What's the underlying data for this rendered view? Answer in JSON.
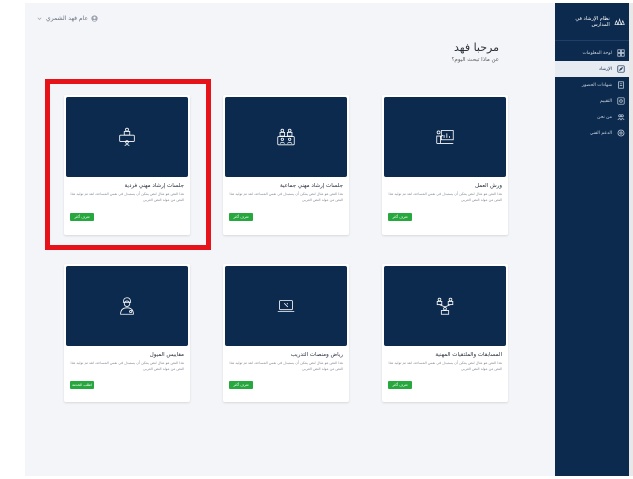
{
  "sidebar": {
    "title": "نظام الإرشاد في المدارس",
    "items": [
      {
        "label": "لوحة المعلومات",
        "icon": "grid-icon",
        "active": false
      },
      {
        "label": "الإرشاد",
        "icon": "compass-icon",
        "active": true
      },
      {
        "label": "شهادات الحضور",
        "icon": "certificate-icon",
        "active": false
      },
      {
        "label": "التقييم",
        "icon": "target-icon",
        "active": false
      },
      {
        "label": "من نحن",
        "icon": "people-icon",
        "active": false
      },
      {
        "label": "الدعم الفني",
        "icon": "headset-icon",
        "active": false
      }
    ]
  },
  "user_menu": {
    "label": "عام فهد الشمري",
    "icon": "user-icon",
    "caret": "chevron-down-icon"
  },
  "welcome": {
    "title": "مرحبا فهد",
    "subtitle": "عن ماذا تبحث اليوم؟"
  },
  "cards": [
    {
      "title": "ورش العمل",
      "desc": "هذا النص هو مثال لنص يمكن أن يستبدل في نفس المساحة، لقد تم توليد هذا النص من مولد النص العربي",
      "button": "تعرف أكثر",
      "icon": "presentation-icon"
    },
    {
      "title": "جلسات إرشاد مهني جماعية",
      "desc": "هذا النص هو مثال لنص يمكن أن يستبدل في نفس المساحة، لقد تم توليد هذا النص من مولد النص العربي",
      "button": "تعرف أكثر",
      "icon": "group-session-icon"
    },
    {
      "title": "جلسات إرشاد مهني فردية",
      "desc": "هذا النص هو مثال لنص يمكن أن يستبدل في نفس المساحة، لقد تم توليد هذا النص من مولد النص العربي",
      "button": "تعرف أكثر",
      "icon": "individual-session-icon"
    },
    {
      "title": "المسابقات والملتقيات المهنية",
      "desc": "هذا النص هو مثال لنص يمكن أن يستبدل في نفس المساحة، لقد تم توليد هذا النص من مولد النص العربي",
      "button": "تعرف أكثر",
      "icon": "competition-icon"
    },
    {
      "title": "رياض ومنصات التدريب",
      "desc": "هذا النص هو مثال لنص يمكن أن يستبدل في نفس المساحة، لقد تم توليد هذا النص من مولد النص العربي",
      "button": "تعرف أكثر",
      "icon": "laptop-icon"
    },
    {
      "title": "مقاييس الميول",
      "desc": "هذا النص هو مثال لنص يمكن أن يستبدل في نفس المساحة، لقد تم توليد هذا النص من مولد النص العربي",
      "button": "اطلب الخدمة",
      "icon": "doctor-icon"
    }
  ],
  "colors": {
    "sidebar_bg": "#0c2a4e",
    "card_image_bg": "#0c2a4e",
    "button_green": "#27a83f",
    "highlight_red": "#e6131b"
  }
}
